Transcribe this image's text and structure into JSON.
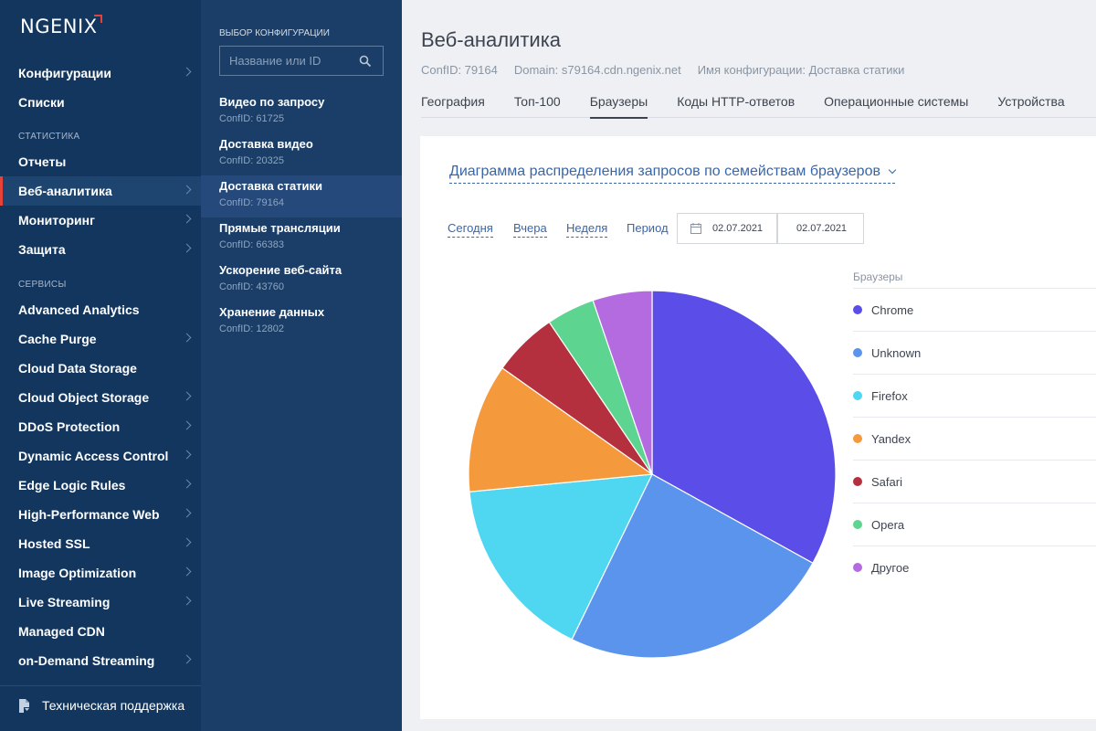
{
  "app": {
    "logo": "NGENIX"
  },
  "sidebar": {
    "top_items": [
      {
        "label": "Конфигурации",
        "chevron": true
      },
      {
        "label": "Списки",
        "chevron": false
      }
    ],
    "section_stats": "Статистика",
    "stats_items": [
      {
        "label": "Отчеты",
        "chevron": false
      },
      {
        "label": "Веб-аналитика",
        "chevron": true,
        "active": true
      },
      {
        "label": "Мониторинг",
        "chevron": true
      },
      {
        "label": "Защита",
        "chevron": true
      }
    ],
    "section_services": "Сервисы",
    "service_items": [
      {
        "label": "Advanced Analytics",
        "chevron": false
      },
      {
        "label": "Cache Purge",
        "chevron": true
      },
      {
        "label": "Cloud Data Storage",
        "chevron": false
      },
      {
        "label": "Cloud Object Storage",
        "chevron": true
      },
      {
        "label": "DDoS Protection",
        "chevron": true
      },
      {
        "label": "Dynamic Access Control",
        "chevron": true
      },
      {
        "label": "Edge Logic Rules",
        "chevron": true
      },
      {
        "label": "High-Performance Web",
        "chevron": true
      },
      {
        "label": "Hosted SSL",
        "chevron": true
      },
      {
        "label": "Image Optimization",
        "chevron": true
      },
      {
        "label": "Live Streaming",
        "chevron": true
      },
      {
        "label": "Managed CDN",
        "chevron": false
      },
      {
        "label": "on-Demand Streaming",
        "chevron": true
      }
    ],
    "support": "Техническая поддержка"
  },
  "config_panel": {
    "label": "Выбор конфигурации",
    "search_placeholder": "Название или ID",
    "configs": [
      {
        "name": "Видео по запросу",
        "id": "ConfID: 61725"
      },
      {
        "name": "Доставка видео",
        "id": "ConfID: 20325"
      },
      {
        "name": "Доставка статики",
        "id": "ConfID: 79164",
        "active": true
      },
      {
        "name": "Прямые трансляции",
        "id": "ConfID: 66383"
      },
      {
        "name": "Ускорение веб-сайта",
        "id": "ConfID: 43760"
      },
      {
        "name": "Хранение данных",
        "id": "ConfID: 12802"
      }
    ]
  },
  "main": {
    "title": "Веб-аналитика",
    "meta": {
      "confid": "ConfID: 79164",
      "domain": "Domain: s79164.cdn.ngenix.net",
      "config_name": "Имя конфигурации: Доставка статики"
    },
    "tabs": [
      "География",
      "Топ-100",
      "Браузеры",
      "Коды HTTP-ответов",
      "Операционные системы",
      "Устройства"
    ],
    "active_tab": 2,
    "chart_selector": "Диаграмма распределения запросов по семействам браузеров",
    "ranges": [
      "Сегодня",
      "Вчера",
      "Неделя"
    ],
    "period_label": "Период",
    "date_from": "02.07.2021",
    "date_to": "02.07.2021",
    "legend_title": "Браузеры"
  },
  "chart_data": {
    "type": "pie",
    "title": "",
    "categories": [
      "Chrome",
      "Unknown",
      "Firefox",
      "Yandex",
      "Safari",
      "Opera",
      "Другое"
    ],
    "values": [
      33.5,
      24.5,
      16.5,
      11.5,
      5.8,
      4.3,
      5.3
    ],
    "colors": [
      "#5b4de8",
      "#5b94ec",
      "#4fd6f0",
      "#f5993d",
      "#b5303f",
      "#5dd590",
      "#b46bdf"
    ],
    "legend_position": "right"
  }
}
